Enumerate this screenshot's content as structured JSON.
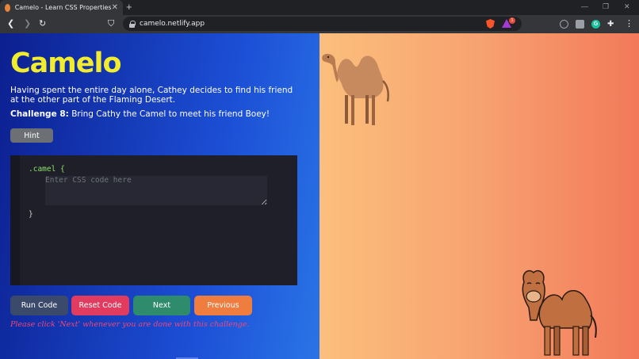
{
  "browser": {
    "tab_title": "Camelo - Learn CSS Properties",
    "tab_close": "✕",
    "new_tab": "+",
    "url": "camelo.netlify.app",
    "rewards_badge": "1"
  },
  "app": {
    "logo": "Camelo",
    "story": "Having spent the entire day alone, Cathey decides to find his friend at the other part of the Flaming Desert.",
    "challenge_label": "Challenge 8:",
    "challenge_text": "Bring Cathy the Camel to meet his friend Boey!",
    "hint_label": "Hint",
    "editor": {
      "selector": ".camel {",
      "closing": "}",
      "input_value": "",
      "placeholder": "Enter CSS code here"
    },
    "buttons": {
      "run": "Run Code",
      "reset": "Reset Code",
      "next": "Next",
      "previous": "Previous"
    },
    "note": "Please click 'Next' whenever you are done with this challenge."
  },
  "colors": {
    "logo": "#f2ec2e",
    "run": "#3b4a6b",
    "reset": "#e13c60",
    "next": "#2e8b6b",
    "previous": "#ef7d3f",
    "note": "#f0467a"
  }
}
